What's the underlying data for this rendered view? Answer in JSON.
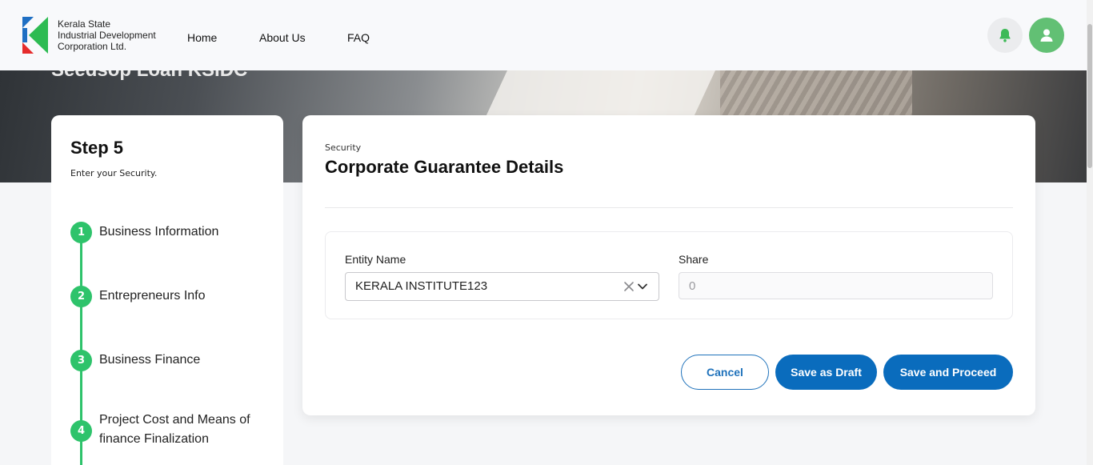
{
  "header": {
    "org_name_lines": [
      "Kerala State",
      "Industrial Development",
      "Corporation Ltd."
    ],
    "nav": [
      {
        "label": "Home"
      },
      {
        "label": "About Us"
      },
      {
        "label": "FAQ"
      }
    ],
    "bell_icon": "bell-icon",
    "user_icon": "user-icon",
    "accent_green": "#62c074"
  },
  "hero": {
    "title": "Seedsop Loan KSIDC"
  },
  "steps": {
    "title": "Step 5",
    "subtitle": "Enter your Security.",
    "items": [
      {
        "number": "1",
        "label": "Business Information"
      },
      {
        "number": "2",
        "label": "Entrepreneurs Info"
      },
      {
        "number": "3",
        "label": "Business Finance"
      },
      {
        "number": "4",
        "label": "Project Cost and Means of finance Finalization"
      }
    ],
    "color": "#2ec36b"
  },
  "form": {
    "eyebrow": "Security",
    "title": "Corporate Guarantee Details",
    "entity_label": "Entity Name",
    "entity_value": "KERALA INSTITUTE123",
    "share_label": "Share",
    "share_placeholder": "0"
  },
  "buttons": {
    "cancel": "Cancel",
    "draft": "Save as Draft",
    "proceed": "Save and Proceed",
    "primary_color": "#0a6cbd"
  }
}
